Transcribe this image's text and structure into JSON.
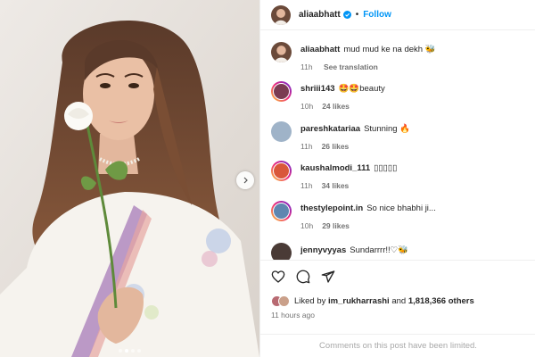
{
  "post": {
    "author": "aliaabhatt",
    "separator": "•",
    "follow_label": "Follow",
    "verified_icon": "verified-badge-icon"
  },
  "caption": {
    "username": "aliaabhatt",
    "text": "mud mud ke na dekh",
    "emoji": "🐝",
    "time": "11h",
    "translate_label": "See translation"
  },
  "comments": [
    {
      "username": "shriii143",
      "text": "🤩🤩beauty",
      "time": "10h",
      "likes": "24 likes",
      "avatar_color": "#7a3b52"
    },
    {
      "username": "pareshkatariaa",
      "text": "Stunning 🔥",
      "time": "11h",
      "likes": "26 likes",
      "avatar_color": "#9fb3c8"
    },
    {
      "username": "kaushalmodi_111",
      "text": "▯▯▯▯▯",
      "time": "11h",
      "likes": "34 likes",
      "avatar_color": "#d9573a"
    },
    {
      "username": "thestylepoint.in",
      "text": "So nice bhabhi ji...",
      "time": "10h",
      "likes": "29 likes",
      "avatar_color": "#5f86b0"
    },
    {
      "username": "jennyvyyas",
      "text": "Sundarrrr!!♡🐝",
      "time": "",
      "likes": "",
      "avatar_color": "#4a3b36"
    }
  ],
  "actions": {
    "like_icon": "heart-icon",
    "comment_icon": "comment-icon",
    "share_icon": "share-icon",
    "liked_prefix": "Liked by",
    "liked_user": "im_rukharrashi",
    "liked_and": "and",
    "liked_count": "1,818,366 others",
    "time_ago": "11 hours ago",
    "comments_limited": "Comments on this post have been limited."
  },
  "carousel": {
    "current_index": 1,
    "total": 4
  },
  "colors": {
    "accent": "#0095f6",
    "muted": "#737373",
    "border": "#efefef"
  }
}
